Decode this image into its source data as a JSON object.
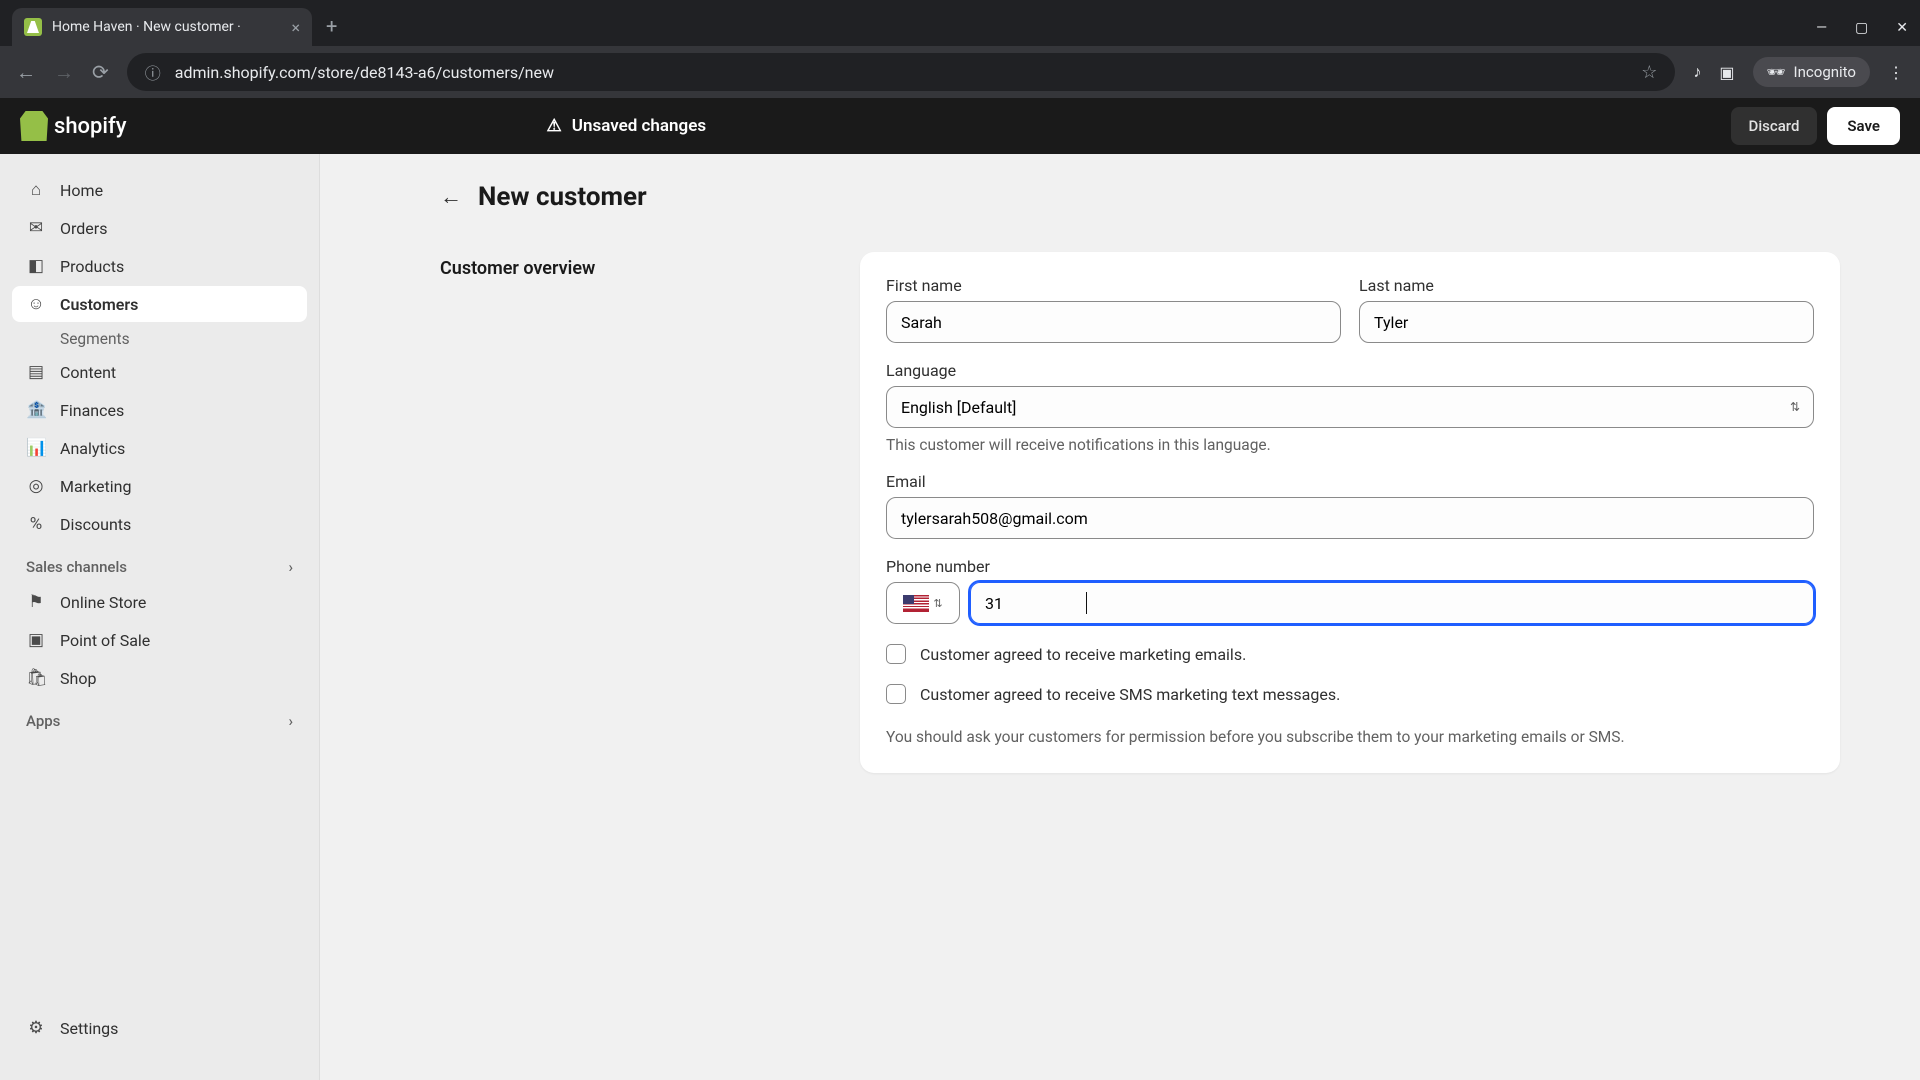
{
  "browser": {
    "tab_title": "Home Haven · New customer ·",
    "url": "admin.shopify.com/store/de8143-a6/customers/new",
    "incognito_label": "Incognito"
  },
  "app_bar": {
    "brand": "shopify",
    "unsaved_label": "Unsaved changes",
    "discard": "Discard",
    "save": "Save"
  },
  "sidebar": {
    "home": "Home",
    "orders": "Orders",
    "products": "Products",
    "customers": "Customers",
    "segments": "Segments",
    "content": "Content",
    "finances": "Finances",
    "analytics": "Analytics",
    "marketing": "Marketing",
    "discounts": "Discounts",
    "sales_channels": "Sales channels",
    "online_store": "Online Store",
    "point_of_sale": "Point of Sale",
    "shop": "Shop",
    "apps": "Apps",
    "settings": "Settings"
  },
  "page": {
    "title": "New customer",
    "section_label": "Customer overview"
  },
  "form": {
    "first_name_label": "First name",
    "first_name_value": "Sarah",
    "last_name_label": "Last name",
    "last_name_value": "Tyler",
    "language_label": "Language",
    "language_value": "English [Default]",
    "language_help": "This customer will receive notifications in this language.",
    "email_label": "Email",
    "email_value": "tylersarah508@gmail.com",
    "phone_label": "Phone number",
    "phone_value": "31",
    "marketing_emails": "Customer agreed to receive marketing emails.",
    "marketing_sms": "Customer agreed to receive SMS marketing text messages.",
    "disclosure": "You should ask your customers for permission before you subscribe them to your marketing emails or SMS."
  }
}
